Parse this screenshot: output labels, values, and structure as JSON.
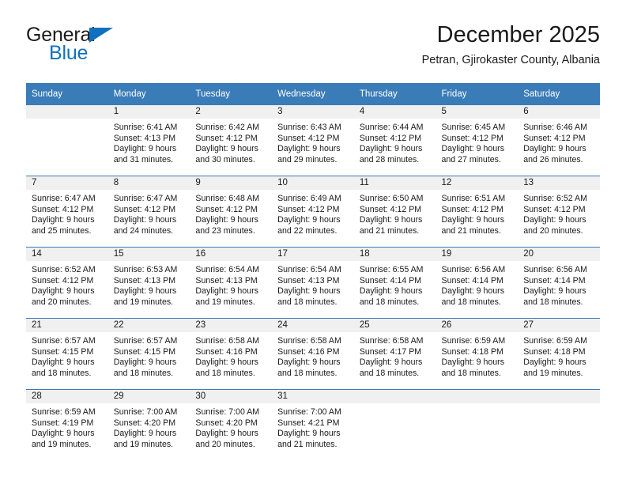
{
  "logo": {
    "word_one": "General",
    "word_two": "Blue",
    "triangle_color": "#1271bf"
  },
  "header": {
    "title": "December 2025",
    "subtitle": "Petran, Gjirokaster County, Albania"
  },
  "theme": {
    "header_blue": "#3a7cb8",
    "daynum_band": "#f0f0f0",
    "text": "#1a1a1a"
  },
  "weekday_headers": [
    "Sunday",
    "Monday",
    "Tuesday",
    "Wednesday",
    "Thursday",
    "Friday",
    "Saturday"
  ],
  "weeks": [
    [
      {
        "day": "",
        "lines": []
      },
      {
        "day": "1",
        "lines": [
          "Sunrise: 6:41 AM",
          "Sunset: 4:13 PM",
          "Daylight: 9 hours",
          "and 31 minutes."
        ]
      },
      {
        "day": "2",
        "lines": [
          "Sunrise: 6:42 AM",
          "Sunset: 4:12 PM",
          "Daylight: 9 hours",
          "and 30 minutes."
        ]
      },
      {
        "day": "3",
        "lines": [
          "Sunrise: 6:43 AM",
          "Sunset: 4:12 PM",
          "Daylight: 9 hours",
          "and 29 minutes."
        ]
      },
      {
        "day": "4",
        "lines": [
          "Sunrise: 6:44 AM",
          "Sunset: 4:12 PM",
          "Daylight: 9 hours",
          "and 28 minutes."
        ]
      },
      {
        "day": "5",
        "lines": [
          "Sunrise: 6:45 AM",
          "Sunset: 4:12 PM",
          "Daylight: 9 hours",
          "and 27 minutes."
        ]
      },
      {
        "day": "6",
        "lines": [
          "Sunrise: 6:46 AM",
          "Sunset: 4:12 PM",
          "Daylight: 9 hours",
          "and 26 minutes."
        ]
      }
    ],
    [
      {
        "day": "7",
        "lines": [
          "Sunrise: 6:47 AM",
          "Sunset: 4:12 PM",
          "Daylight: 9 hours",
          "and 25 minutes."
        ]
      },
      {
        "day": "8",
        "lines": [
          "Sunrise: 6:47 AM",
          "Sunset: 4:12 PM",
          "Daylight: 9 hours",
          "and 24 minutes."
        ]
      },
      {
        "day": "9",
        "lines": [
          "Sunrise: 6:48 AM",
          "Sunset: 4:12 PM",
          "Daylight: 9 hours",
          "and 23 minutes."
        ]
      },
      {
        "day": "10",
        "lines": [
          "Sunrise: 6:49 AM",
          "Sunset: 4:12 PM",
          "Daylight: 9 hours",
          "and 22 minutes."
        ]
      },
      {
        "day": "11",
        "lines": [
          "Sunrise: 6:50 AM",
          "Sunset: 4:12 PM",
          "Daylight: 9 hours",
          "and 21 minutes."
        ]
      },
      {
        "day": "12",
        "lines": [
          "Sunrise: 6:51 AM",
          "Sunset: 4:12 PM",
          "Daylight: 9 hours",
          "and 21 minutes."
        ]
      },
      {
        "day": "13",
        "lines": [
          "Sunrise: 6:52 AM",
          "Sunset: 4:12 PM",
          "Daylight: 9 hours",
          "and 20 minutes."
        ]
      }
    ],
    [
      {
        "day": "14",
        "lines": [
          "Sunrise: 6:52 AM",
          "Sunset: 4:12 PM",
          "Daylight: 9 hours",
          "and 20 minutes."
        ]
      },
      {
        "day": "15",
        "lines": [
          "Sunrise: 6:53 AM",
          "Sunset: 4:13 PM",
          "Daylight: 9 hours",
          "and 19 minutes."
        ]
      },
      {
        "day": "16",
        "lines": [
          "Sunrise: 6:54 AM",
          "Sunset: 4:13 PM",
          "Daylight: 9 hours",
          "and 19 minutes."
        ]
      },
      {
        "day": "17",
        "lines": [
          "Sunrise: 6:54 AM",
          "Sunset: 4:13 PM",
          "Daylight: 9 hours",
          "and 18 minutes."
        ]
      },
      {
        "day": "18",
        "lines": [
          "Sunrise: 6:55 AM",
          "Sunset: 4:14 PM",
          "Daylight: 9 hours",
          "and 18 minutes."
        ]
      },
      {
        "day": "19",
        "lines": [
          "Sunrise: 6:56 AM",
          "Sunset: 4:14 PM",
          "Daylight: 9 hours",
          "and 18 minutes."
        ]
      },
      {
        "day": "20",
        "lines": [
          "Sunrise: 6:56 AM",
          "Sunset: 4:14 PM",
          "Daylight: 9 hours",
          "and 18 minutes."
        ]
      }
    ],
    [
      {
        "day": "21",
        "lines": [
          "Sunrise: 6:57 AM",
          "Sunset: 4:15 PM",
          "Daylight: 9 hours",
          "and 18 minutes."
        ]
      },
      {
        "day": "22",
        "lines": [
          "Sunrise: 6:57 AM",
          "Sunset: 4:15 PM",
          "Daylight: 9 hours",
          "and 18 minutes."
        ]
      },
      {
        "day": "23",
        "lines": [
          "Sunrise: 6:58 AM",
          "Sunset: 4:16 PM",
          "Daylight: 9 hours",
          "and 18 minutes."
        ]
      },
      {
        "day": "24",
        "lines": [
          "Sunrise: 6:58 AM",
          "Sunset: 4:16 PM",
          "Daylight: 9 hours",
          "and 18 minutes."
        ]
      },
      {
        "day": "25",
        "lines": [
          "Sunrise: 6:58 AM",
          "Sunset: 4:17 PM",
          "Daylight: 9 hours",
          "and 18 minutes."
        ]
      },
      {
        "day": "26",
        "lines": [
          "Sunrise: 6:59 AM",
          "Sunset: 4:18 PM",
          "Daylight: 9 hours",
          "and 18 minutes."
        ]
      },
      {
        "day": "27",
        "lines": [
          "Sunrise: 6:59 AM",
          "Sunset: 4:18 PM",
          "Daylight: 9 hours",
          "and 19 minutes."
        ]
      }
    ],
    [
      {
        "day": "28",
        "lines": [
          "Sunrise: 6:59 AM",
          "Sunset: 4:19 PM",
          "Daylight: 9 hours",
          "and 19 minutes."
        ]
      },
      {
        "day": "29",
        "lines": [
          "Sunrise: 7:00 AM",
          "Sunset: 4:20 PM",
          "Daylight: 9 hours",
          "and 19 minutes."
        ]
      },
      {
        "day": "30",
        "lines": [
          "Sunrise: 7:00 AM",
          "Sunset: 4:20 PM",
          "Daylight: 9 hours",
          "and 20 minutes."
        ]
      },
      {
        "day": "31",
        "lines": [
          "Sunrise: 7:00 AM",
          "Sunset: 4:21 PM",
          "Daylight: 9 hours",
          "and 21 minutes."
        ]
      },
      {
        "day": "",
        "lines": []
      },
      {
        "day": "",
        "lines": []
      },
      {
        "day": "",
        "lines": []
      }
    ]
  ]
}
